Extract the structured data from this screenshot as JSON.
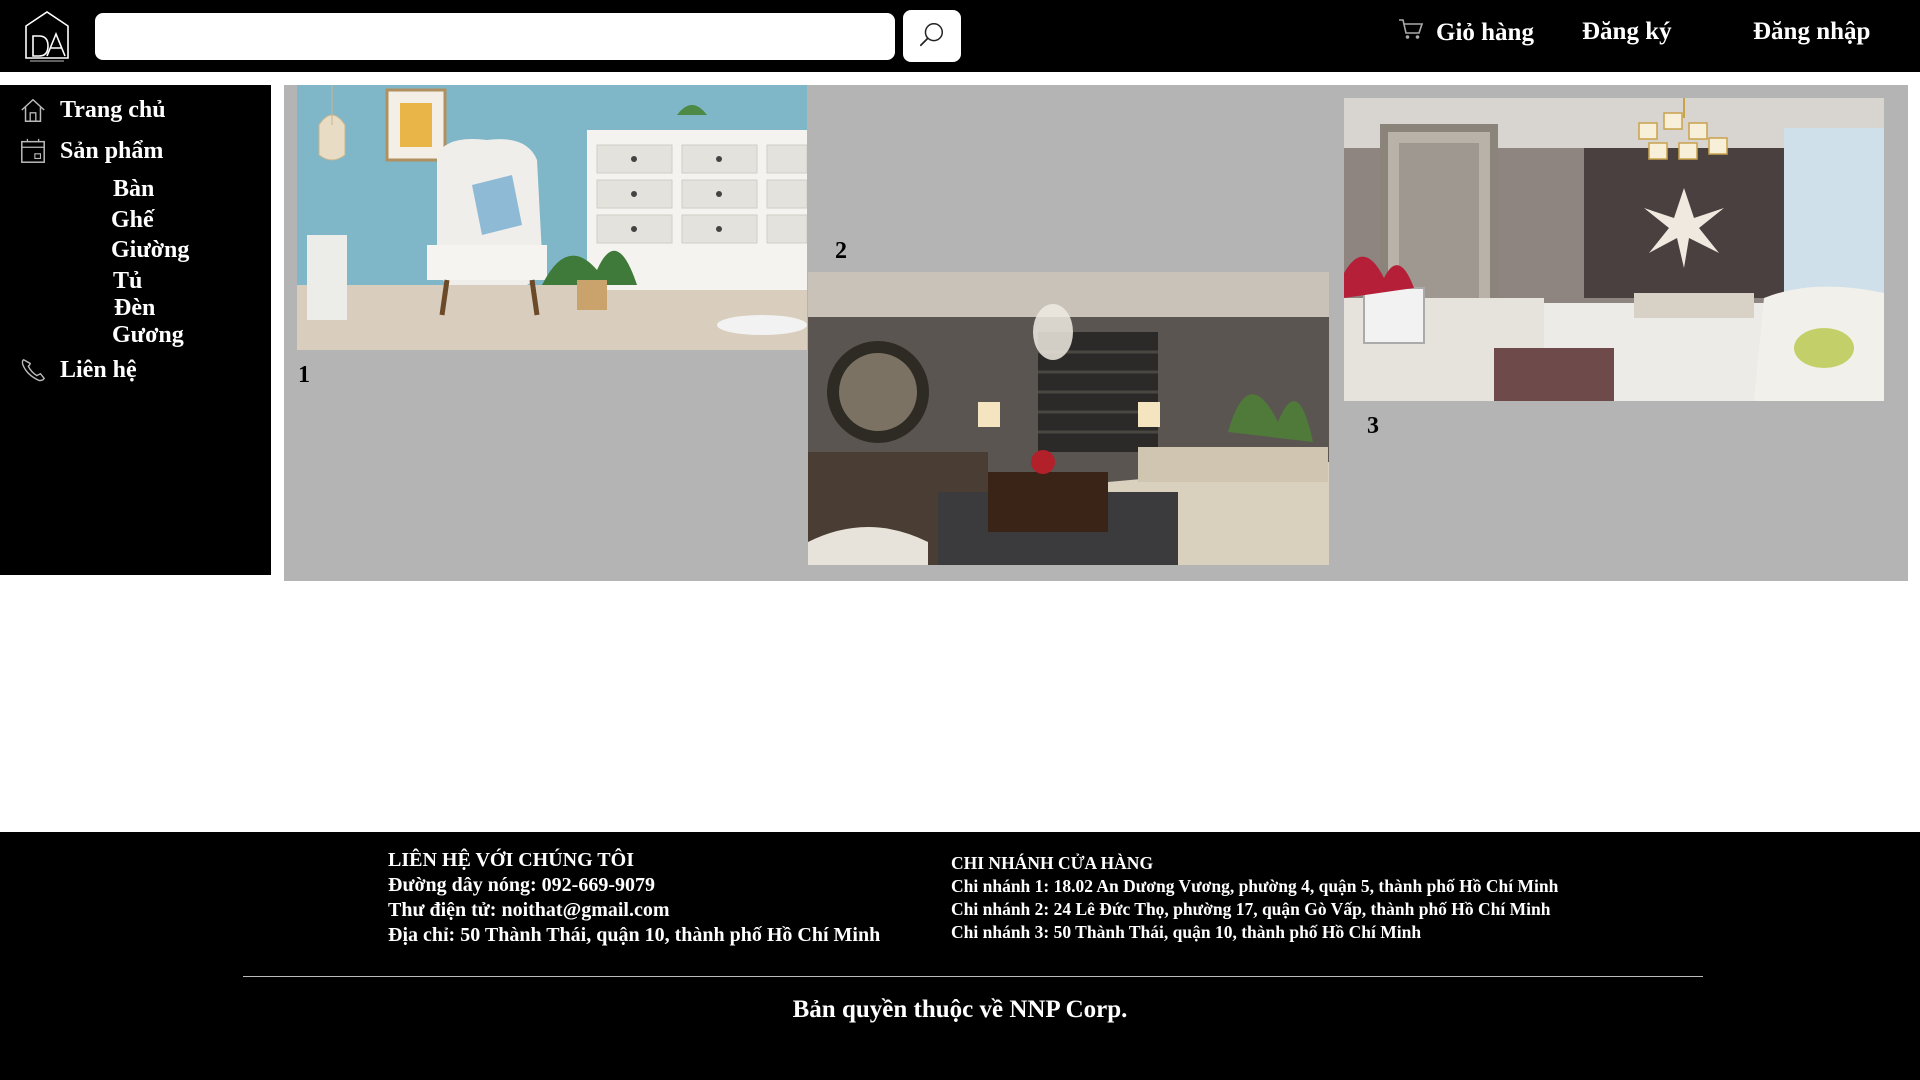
{
  "header": {
    "search": {
      "placeholder": "",
      "value": ""
    },
    "cart_label": "Giỏ hàng",
    "register_label": "Đăng ký",
    "login_label": "Đăng nhập"
  },
  "sidebar": {
    "home_label": "Trang chủ",
    "products_label": "Sản phẩm",
    "sub_items": [
      "Bàn",
      "Ghế",
      "Giường",
      "Tủ",
      "Đèn",
      "Gương"
    ],
    "contact_label": "Liên hệ"
  },
  "gallery": {
    "slides": [
      {
        "number": "1",
        "icon": "living-room-chair-photo"
      },
      {
        "number": "2",
        "icon": "lounge-room-photo"
      },
      {
        "number": "3",
        "icon": "bedroom-chandelier-photo"
      }
    ]
  },
  "footer": {
    "contact": {
      "heading": "LIÊN HỆ VỚI CHÚNG TÔI",
      "hotline": "Đường dây nóng:  092-669-9079",
      "email": "Thư điện tử: noithat@gmail.com",
      "address": "Địa chỉ: 50 Thành Thái, quận 10, thành phố Hồ Chí Minh"
    },
    "branches": {
      "heading": "CHI NHÁNH CỬA HÀNG",
      "branch1": "Chi nhánh 1: 18.02 An Dương Vương, phường 4, quận 5, thành phố Hồ Chí Minh",
      "branch2": "Chi nhánh 2: 24 Lê Đức Thọ, phường 17, quận Gò Vấp, thành phố Hồ Chí Minh",
      "branch3": "Chi nhánh 3: 50 Thành Thái, quận 10, thành phố Hồ Chí Minh"
    },
    "copyright": "Bản quyền thuộc về NNP Corp."
  }
}
